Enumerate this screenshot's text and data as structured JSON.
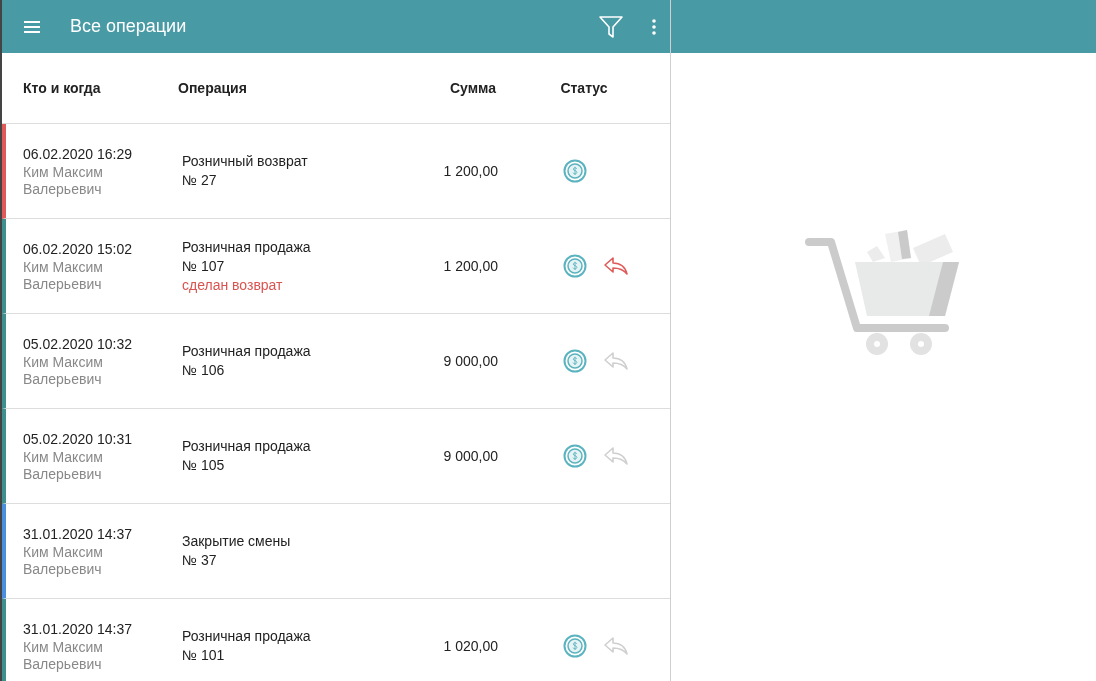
{
  "app_bar": {
    "title": "Все операции"
  },
  "table": {
    "columns": [
      "Кто и когда",
      "Операция",
      "Сумма",
      "Статус"
    ],
    "rows": [
      {
        "color": "#e05a5a",
        "datetime": "06.02.2020 16:29",
        "person": "Ким Максим Валерьевич",
        "operation": "Розничный возврат",
        "number": "№ 27",
        "amount": "1 200,00",
        "paid": true
      },
      {
        "color": "#3f8f8f",
        "datetime": "06.02.2020 15:02",
        "person": "Ким Максим Валерьевич",
        "operation": "Розничная продажа",
        "number": "№ 107",
        "note": "сделан возврат",
        "amount": "1 200,00",
        "paid": true,
        "refunded": true
      },
      {
        "color": "#3f8f8f",
        "datetime": "05.02.2020 10:32",
        "person": "Ким Максим Валерьевич",
        "operation": "Розничная продажа",
        "number": "№ 106",
        "amount": "9 000,00",
        "paid": true,
        "refunded": false
      },
      {
        "color": "#3f8f8f",
        "datetime": "05.02.2020 10:31",
        "person": "Ким Максим Валерьевич",
        "operation": "Розничная продажа",
        "number": "№ 105",
        "amount": "9 000,00",
        "paid": true,
        "refunded": false
      },
      {
        "color": "#4a8ee0",
        "datetime": "31.01.2020 14:37",
        "person": "Ким Максим Валерьевич",
        "operation": "Закрытие смены",
        "number": "№ 37",
        "paid": false
      },
      {
        "color": "#3f8f8f",
        "datetime": "31.01.2020 14:37",
        "person": "Ким Максим Валерьевич",
        "operation": "Розничная продажа",
        "number": "№ 101",
        "amount": "1 020,00",
        "paid": true,
        "refunded": false
      }
    ]
  }
}
